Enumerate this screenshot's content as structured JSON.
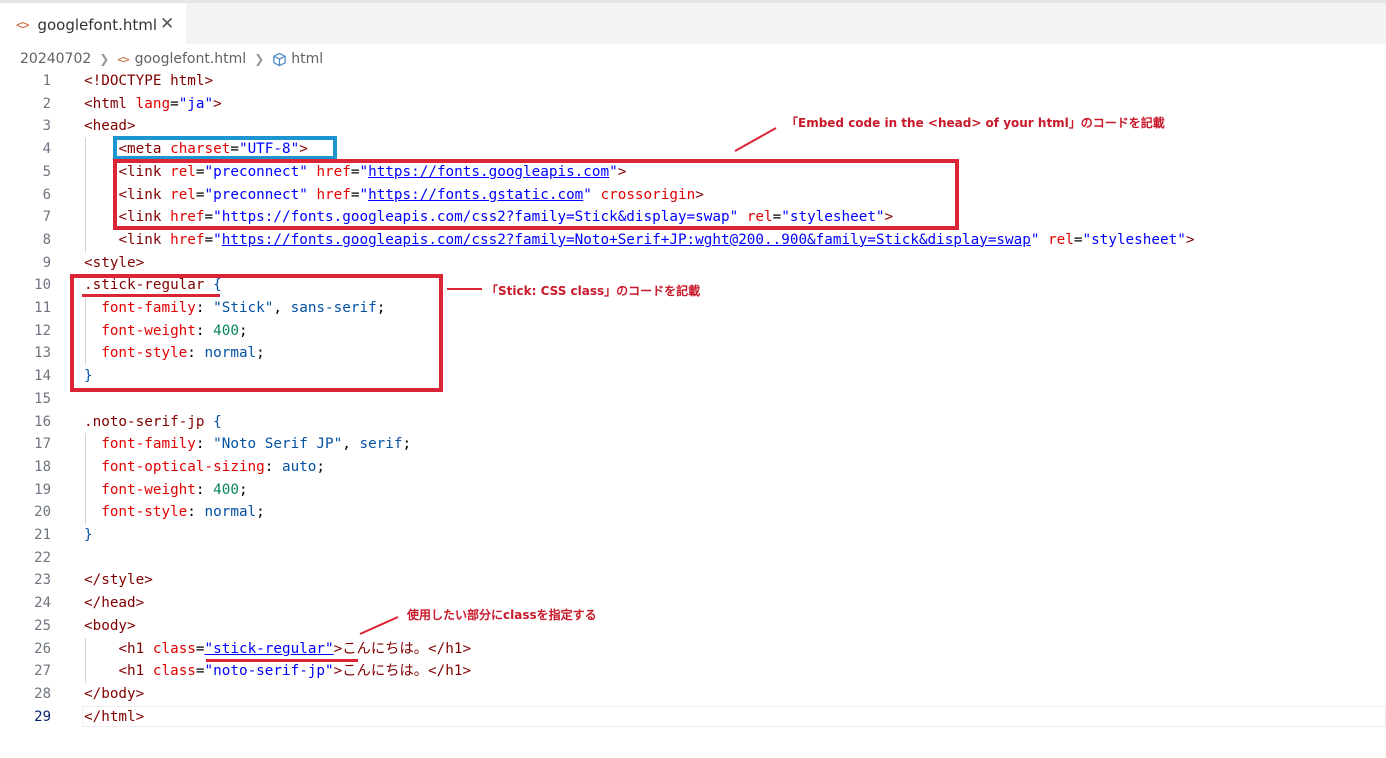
{
  "tab": {
    "icon": "<>",
    "title": "googlefont.html",
    "close": "✕"
  },
  "breadcrumb": {
    "folder": "20240702",
    "file": "googlefont.html",
    "symbol": "html"
  },
  "lines": [
    {
      "n": "1",
      "segs": [
        [
          "t",
          "<!DOCTYPE html>"
        ]
      ]
    },
    {
      "n": "2",
      "segs": [
        [
          "t",
          "<html "
        ],
        [
          "a",
          "lang"
        ],
        [
          "p",
          "="
        ],
        [
          "s",
          "\"ja\""
        ],
        [
          "t",
          ">"
        ]
      ]
    },
    {
      "n": "3",
      "segs": [
        [
          "t",
          "<head>"
        ]
      ]
    },
    {
      "n": "4",
      "segs": [
        [
          "p",
          "    "
        ],
        [
          "t",
          "<meta "
        ],
        [
          "a",
          "charset"
        ],
        [
          "p",
          "="
        ],
        [
          "s",
          "\"UTF-8\""
        ],
        [
          "t",
          ">"
        ]
      ]
    },
    {
      "n": "5",
      "segs": [
        [
          "p",
          "    "
        ],
        [
          "t",
          "<link "
        ],
        [
          "a",
          "rel"
        ],
        [
          "p",
          "="
        ],
        [
          "s",
          "\"preconnect\" "
        ],
        [
          "a",
          "href"
        ],
        [
          "p",
          "="
        ],
        [
          "s",
          "\""
        ],
        [
          "su",
          "https://fonts.googleapis.com"
        ],
        [
          "s",
          "\""
        ],
        [
          "t",
          ">"
        ]
      ]
    },
    {
      "n": "6",
      "segs": [
        [
          "p",
          "    "
        ],
        [
          "t",
          "<link "
        ],
        [
          "a",
          "rel"
        ],
        [
          "p",
          "="
        ],
        [
          "s",
          "\"preconnect\" "
        ],
        [
          "a",
          "href"
        ],
        [
          "p",
          "="
        ],
        [
          "s",
          "\""
        ],
        [
          "su",
          "https://fonts.gstatic.com"
        ],
        [
          "s",
          "\" "
        ],
        [
          "a",
          "crossorigin"
        ],
        [
          "t",
          ">"
        ]
      ]
    },
    {
      "n": "7",
      "segs": [
        [
          "p",
          "    "
        ],
        [
          "t",
          "<link "
        ],
        [
          "a",
          "href"
        ],
        [
          "p",
          "="
        ],
        [
          "s",
          "\"https://fonts.googleapis.com/css2?family=Stick&display=swap\" "
        ],
        [
          "a",
          "rel"
        ],
        [
          "p",
          "="
        ],
        [
          "s",
          "\"stylesheet\""
        ],
        [
          "t",
          ">"
        ]
      ]
    },
    {
      "n": "8",
      "segs": [
        [
          "p",
          "    "
        ],
        [
          "t",
          "<link "
        ],
        [
          "a",
          "href"
        ],
        [
          "p",
          "="
        ],
        [
          "s",
          "\""
        ],
        [
          "su",
          "https://fonts.googleapis.com/css2?family=Noto+Serif+JP:wght@200..900&family=Stick&display=swap"
        ],
        [
          "s",
          "\" "
        ],
        [
          "a",
          "rel"
        ],
        [
          "p",
          "="
        ],
        [
          "s",
          "\"stylesheet\""
        ],
        [
          "t",
          ">"
        ]
      ]
    },
    {
      "n": "9",
      "segs": [
        [
          "t",
          "<style>"
        ]
      ]
    },
    {
      "n": "10",
      "segs": [
        [
          "sel",
          ".stick-regular"
        ],
        [
          "p",
          " "
        ],
        [
          "cval",
          "{"
        ]
      ]
    },
    {
      "n": "11",
      "segs": [
        [
          "p",
          "  "
        ],
        [
          "prop",
          "font-family"
        ],
        [
          "p",
          ": "
        ],
        [
          "cval",
          "\"Stick\""
        ],
        [
          "p",
          ", "
        ],
        [
          "cval",
          "sans-serif"
        ],
        [
          "p",
          ";"
        ]
      ]
    },
    {
      "n": "12",
      "segs": [
        [
          "p",
          "  "
        ],
        [
          "prop",
          "font-weight"
        ],
        [
          "p",
          ": "
        ],
        [
          "num",
          "400"
        ],
        [
          "p",
          ";"
        ]
      ]
    },
    {
      "n": "13",
      "segs": [
        [
          "p",
          "  "
        ],
        [
          "prop",
          "font-style"
        ],
        [
          "p",
          ": "
        ],
        [
          "cval",
          "normal"
        ],
        [
          "p",
          ";"
        ]
      ]
    },
    {
      "n": "14",
      "segs": [
        [
          "cval",
          "}"
        ]
      ]
    },
    {
      "n": "15",
      "segs": []
    },
    {
      "n": "16",
      "segs": [
        [
          "sel",
          ".noto-serif-jp"
        ],
        [
          "p",
          " "
        ],
        [
          "cval",
          "{"
        ]
      ]
    },
    {
      "n": "17",
      "segs": [
        [
          "p",
          "  "
        ],
        [
          "prop",
          "font-family"
        ],
        [
          "p",
          ": "
        ],
        [
          "cval",
          "\"Noto Serif JP\""
        ],
        [
          "p",
          ", "
        ],
        [
          "cval",
          "serif"
        ],
        [
          "p",
          ";"
        ]
      ]
    },
    {
      "n": "18",
      "segs": [
        [
          "p",
          "  "
        ],
        [
          "prop",
          "font-optical-sizing"
        ],
        [
          "p",
          ": "
        ],
        [
          "cval",
          "auto"
        ],
        [
          "p",
          ";"
        ]
      ]
    },
    {
      "n": "19",
      "segs": [
        [
          "p",
          "  "
        ],
        [
          "prop",
          "font-weight"
        ],
        [
          "p",
          ": "
        ],
        [
          "num",
          "400"
        ],
        [
          "p",
          ";"
        ]
      ]
    },
    {
      "n": "20",
      "segs": [
        [
          "p",
          "  "
        ],
        [
          "prop",
          "font-style"
        ],
        [
          "p",
          ": "
        ],
        [
          "cval",
          "normal"
        ],
        [
          "p",
          ";"
        ]
      ]
    },
    {
      "n": "21",
      "segs": [
        [
          "cval",
          "}"
        ]
      ]
    },
    {
      "n": "22",
      "segs": []
    },
    {
      "n": "23",
      "segs": [
        [
          "t",
          "</style>"
        ]
      ]
    },
    {
      "n": "24",
      "segs": [
        [
          "t",
          "</head>"
        ]
      ]
    },
    {
      "n": "25",
      "segs": [
        [
          "t",
          "<body>"
        ]
      ]
    },
    {
      "n": "26",
      "segs": [
        [
          "p",
          "    "
        ],
        [
          "t",
          "<h1 "
        ],
        [
          "a",
          "class"
        ],
        [
          "p",
          "="
        ],
        [
          "su",
          "\"stick-regular\""
        ],
        [
          "t",
          ">"
        ],
        [
          "jp",
          "こんにちは。"
        ],
        [
          "t",
          "</h1>"
        ]
      ]
    },
    {
      "n": "27",
      "segs": [
        [
          "p",
          "    "
        ],
        [
          "t",
          "<h1 "
        ],
        [
          "a",
          "class"
        ],
        [
          "p",
          "="
        ],
        [
          "s",
          "\"noto-serif-jp\""
        ],
        [
          "t",
          ">"
        ],
        [
          "jp",
          "こんにちは。"
        ],
        [
          "t",
          "</h1>"
        ]
      ]
    },
    {
      "n": "28",
      "segs": [
        [
          "t",
          "</body>"
        ]
      ]
    },
    {
      "n": "29",
      "segs": [
        [
          "t",
          "</html>"
        ]
      ]
    }
  ],
  "active_line": "29",
  "annotations": {
    "head_note": "「Embed code in the <head> of your html」のコードを記載",
    "css_note": "「Stick: CSS class」のコードを記載",
    "body_note": "使用したい部分にclassを指定する"
  },
  "colors": {
    "tag": "#800000",
    "attribute": "#e50000",
    "string": "#0000ff",
    "css_value": "#0451a5",
    "number": "#098658",
    "annotation_red": "#db2536",
    "annotation_blue": "#1c95d0"
  }
}
